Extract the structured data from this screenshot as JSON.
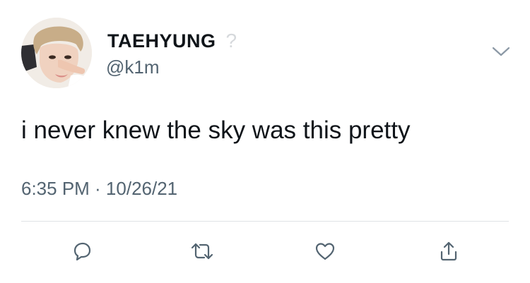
{
  "tweet": {
    "author": {
      "display_name": "TAEHYUNG",
      "name_suffix": "?",
      "handle": "@k1m",
      "avatar_icon": "profile-photo"
    },
    "text": "i never knew the sky was this pretty",
    "timestamp": "6:35 PM · 10/26/21"
  },
  "actions": [
    {
      "name": "reply",
      "icon": "speech-bubble-icon"
    },
    {
      "name": "retweet",
      "icon": "retweet-arrows-icon"
    },
    {
      "name": "like",
      "icon": "heart-icon"
    },
    {
      "name": "share",
      "icon": "share-arrow-icon"
    }
  ],
  "colors": {
    "text_primary": "#0f1419",
    "text_secondary": "#536471",
    "divider": "#dfe3e6",
    "icon": "#536471"
  }
}
